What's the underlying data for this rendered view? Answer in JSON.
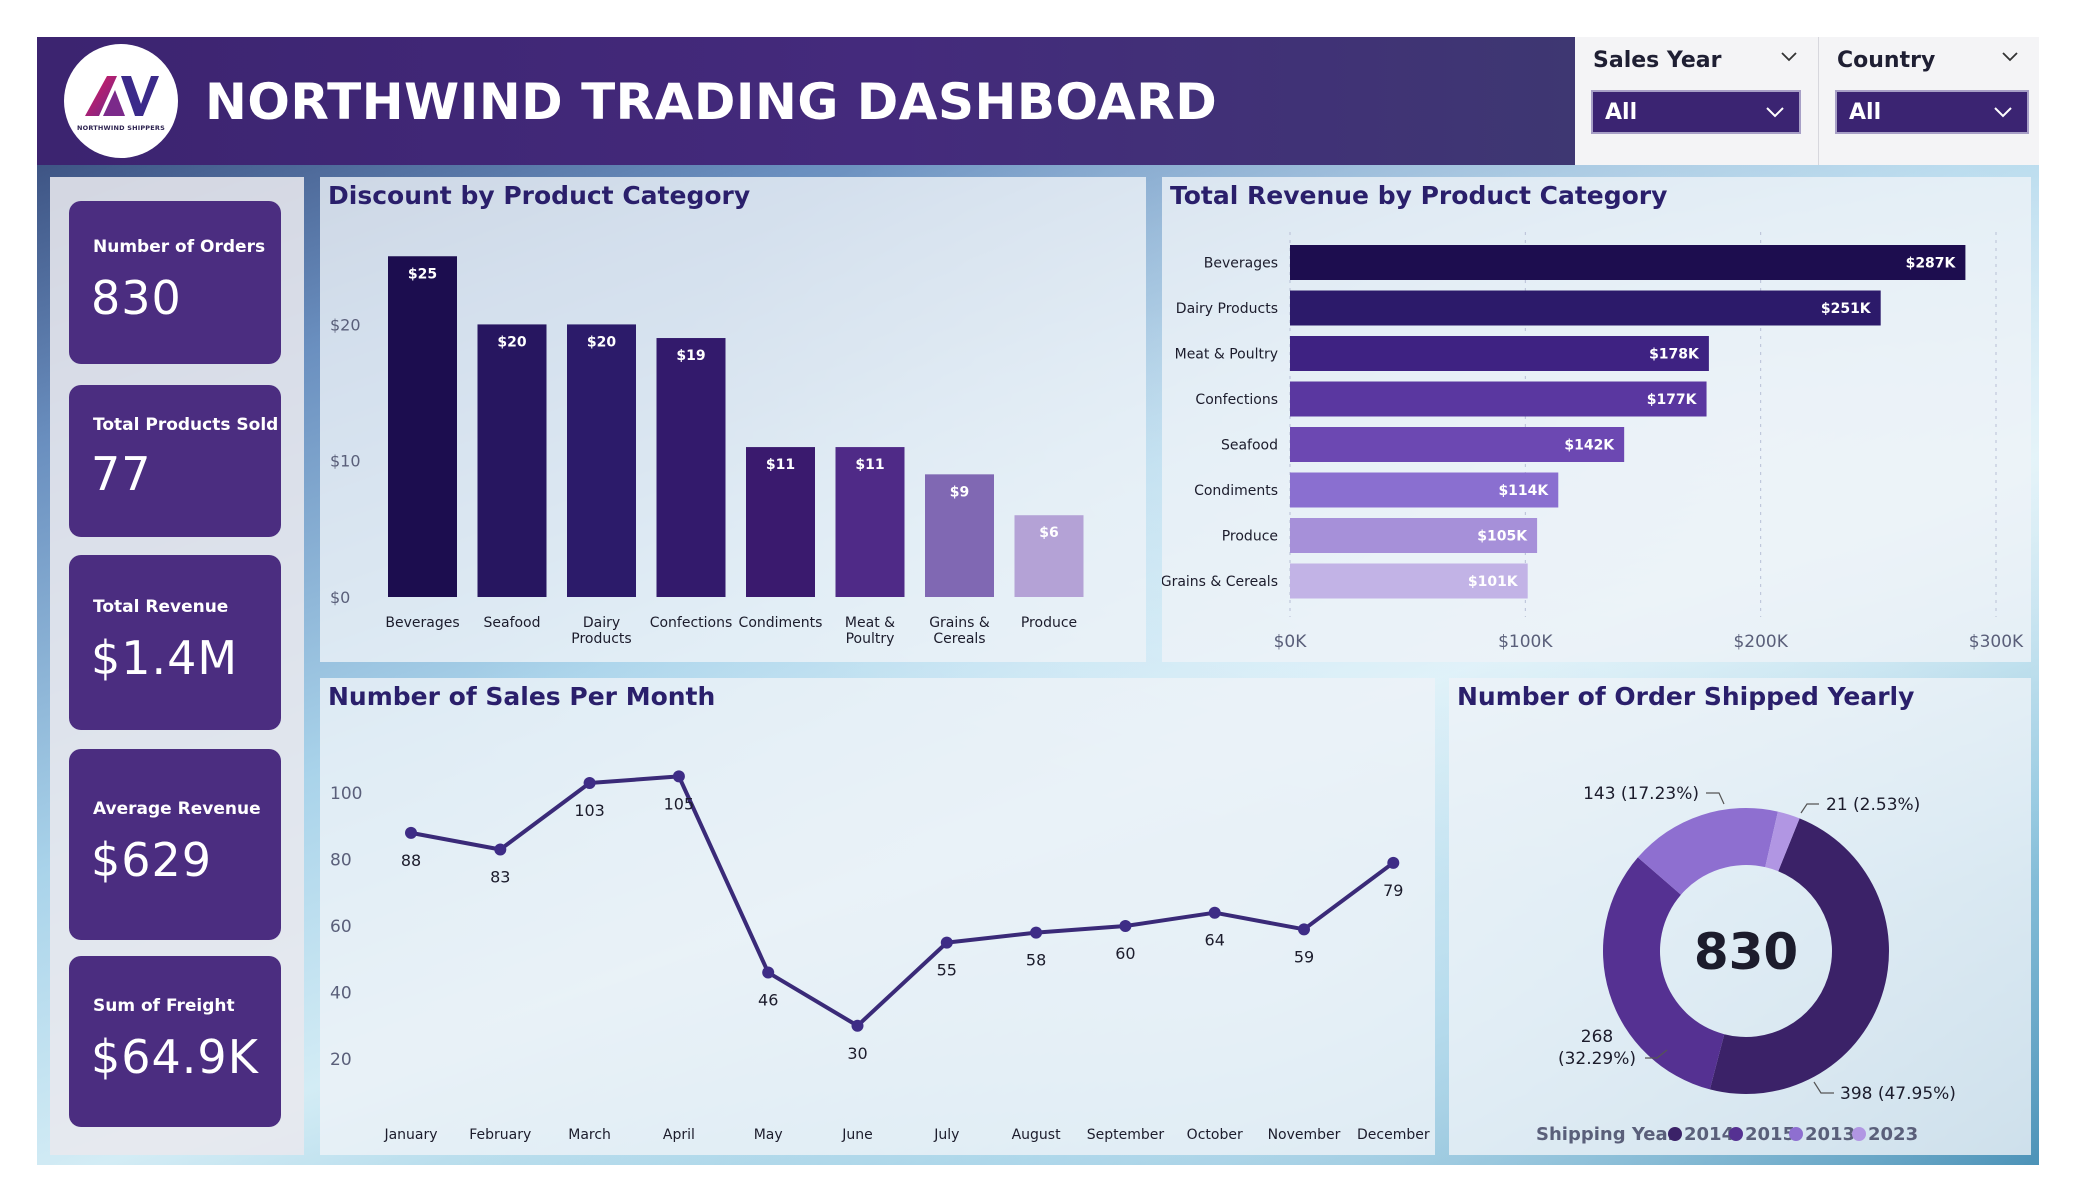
{
  "header": {
    "title": "NORTHWIND TRADING DASHBOARD",
    "logo_text": "NORTHWIND SHIPPERS"
  },
  "slicers": {
    "year": {
      "label": "Sales Year",
      "value": "All"
    },
    "country": {
      "label": "Country",
      "value": "All"
    }
  },
  "kpis": [
    {
      "label": "Number of Orders",
      "value": "830"
    },
    {
      "label": "Total Products Sold",
      "value": "77"
    },
    {
      "label": "Total Revenue",
      "value": "$1.4M"
    },
    {
      "label": "Average Revenue",
      "value": "$629"
    },
    {
      "label": "Sum of Freight",
      "value": "$64.9K"
    }
  ],
  "discount_chart": {
    "title": "Discount by Product Category",
    "chart_data": {
      "type": "bar",
      "categories": [
        "Beverages",
        "Seafood",
        "Dairy Products",
        "Confections",
        "Condiments",
        "Meat & Poultry",
        "Grains & Cereals",
        "Produce"
      ],
      "category_lines": [
        [
          "Beverages"
        ],
        [
          "Seafood"
        ],
        [
          "Dairy",
          "Products"
        ],
        [
          "Confections"
        ],
        [
          "Condiments"
        ],
        [
          "Meat &",
          "Poultry"
        ],
        [
          "Grains &",
          "Cereals"
        ],
        [
          "Produce"
        ]
      ],
      "values": [
        25,
        20,
        20,
        19,
        11,
        11,
        9,
        6
      ],
      "labels": [
        "$25",
        "$20",
        "$20",
        "$19",
        "$11",
        "$11",
        "$9",
        "$6"
      ],
      "yticks": [
        "$0",
        "$10",
        "$20"
      ],
      "ylim": [
        0,
        27
      ],
      "colors": [
        "#1c0d4f",
        "#271660",
        "#2c1b6a",
        "#331a6c",
        "#3a1a6e",
        "#4f2a87",
        "#8068b3",
        "#b4a2d6"
      ]
    }
  },
  "revenue_chart": {
    "title": "Total Revenue by Product Category",
    "chart_data": {
      "type": "bar",
      "orientation": "horizontal",
      "categories": [
        "Beverages",
        "Dairy Products",
        "Meat & Poultry",
        "Confections",
        "Seafood",
        "Condiments",
        "Produce",
        "Grains & Cereals"
      ],
      "values": [
        287,
        251,
        178,
        177,
        142,
        114,
        105,
        101
      ],
      "labels": [
        "$287K",
        "$251K",
        "$178K",
        "$177K",
        "$142K",
        "$114K",
        "$105K",
        "$101K"
      ],
      "xticks": [
        "$0K",
        "$100K",
        "$200K",
        "$300K"
      ],
      "xlim": [
        0,
        300
      ],
      "colors": [
        "#1d0d4f",
        "#2c1a6a",
        "#3e2282",
        "#5a37a0",
        "#6c48b2",
        "#8a6fd0",
        "#a690d9",
        "#c2b3e6"
      ]
    }
  },
  "sales_chart": {
    "title": "Number of Sales Per Month",
    "chart_data": {
      "type": "line",
      "categories": [
        "January",
        "February",
        "March",
        "April",
        "May",
        "June",
        "July",
        "August",
        "September",
        "October",
        "November",
        "December"
      ],
      "values": [
        88,
        83,
        103,
        105,
        46,
        30,
        55,
        58,
        60,
        64,
        59,
        79
      ],
      "yticks": [
        20,
        40,
        60,
        80,
        100
      ],
      "ylim": [
        0,
        110
      ],
      "color": "#3a2a78"
    }
  },
  "shipped_chart": {
    "title": "Number of Order Shipped Yearly",
    "center_value": "830",
    "legend_title": "Shipping Year",
    "chart_data": {
      "type": "pie",
      "donut": true,
      "series": [
        {
          "name": "2014",
          "value": 398,
          "label": "398 (47.95%)",
          "color": "#3b2268"
        },
        {
          "name": "2015",
          "value": 268,
          "label_lines": [
            "268",
            "(32.29%)"
          ],
          "color": "#553192"
        },
        {
          "name": "2013",
          "value": 143,
          "label": "143 (17.23%)",
          "color": "#8e6fd0"
        },
        {
          "name": "2023",
          "value": 21,
          "label": "21 (2.53%)",
          "color": "#b196e3"
        }
      ],
      "legend": [
        "2014",
        "2015",
        "2013",
        "2023"
      ]
    }
  }
}
